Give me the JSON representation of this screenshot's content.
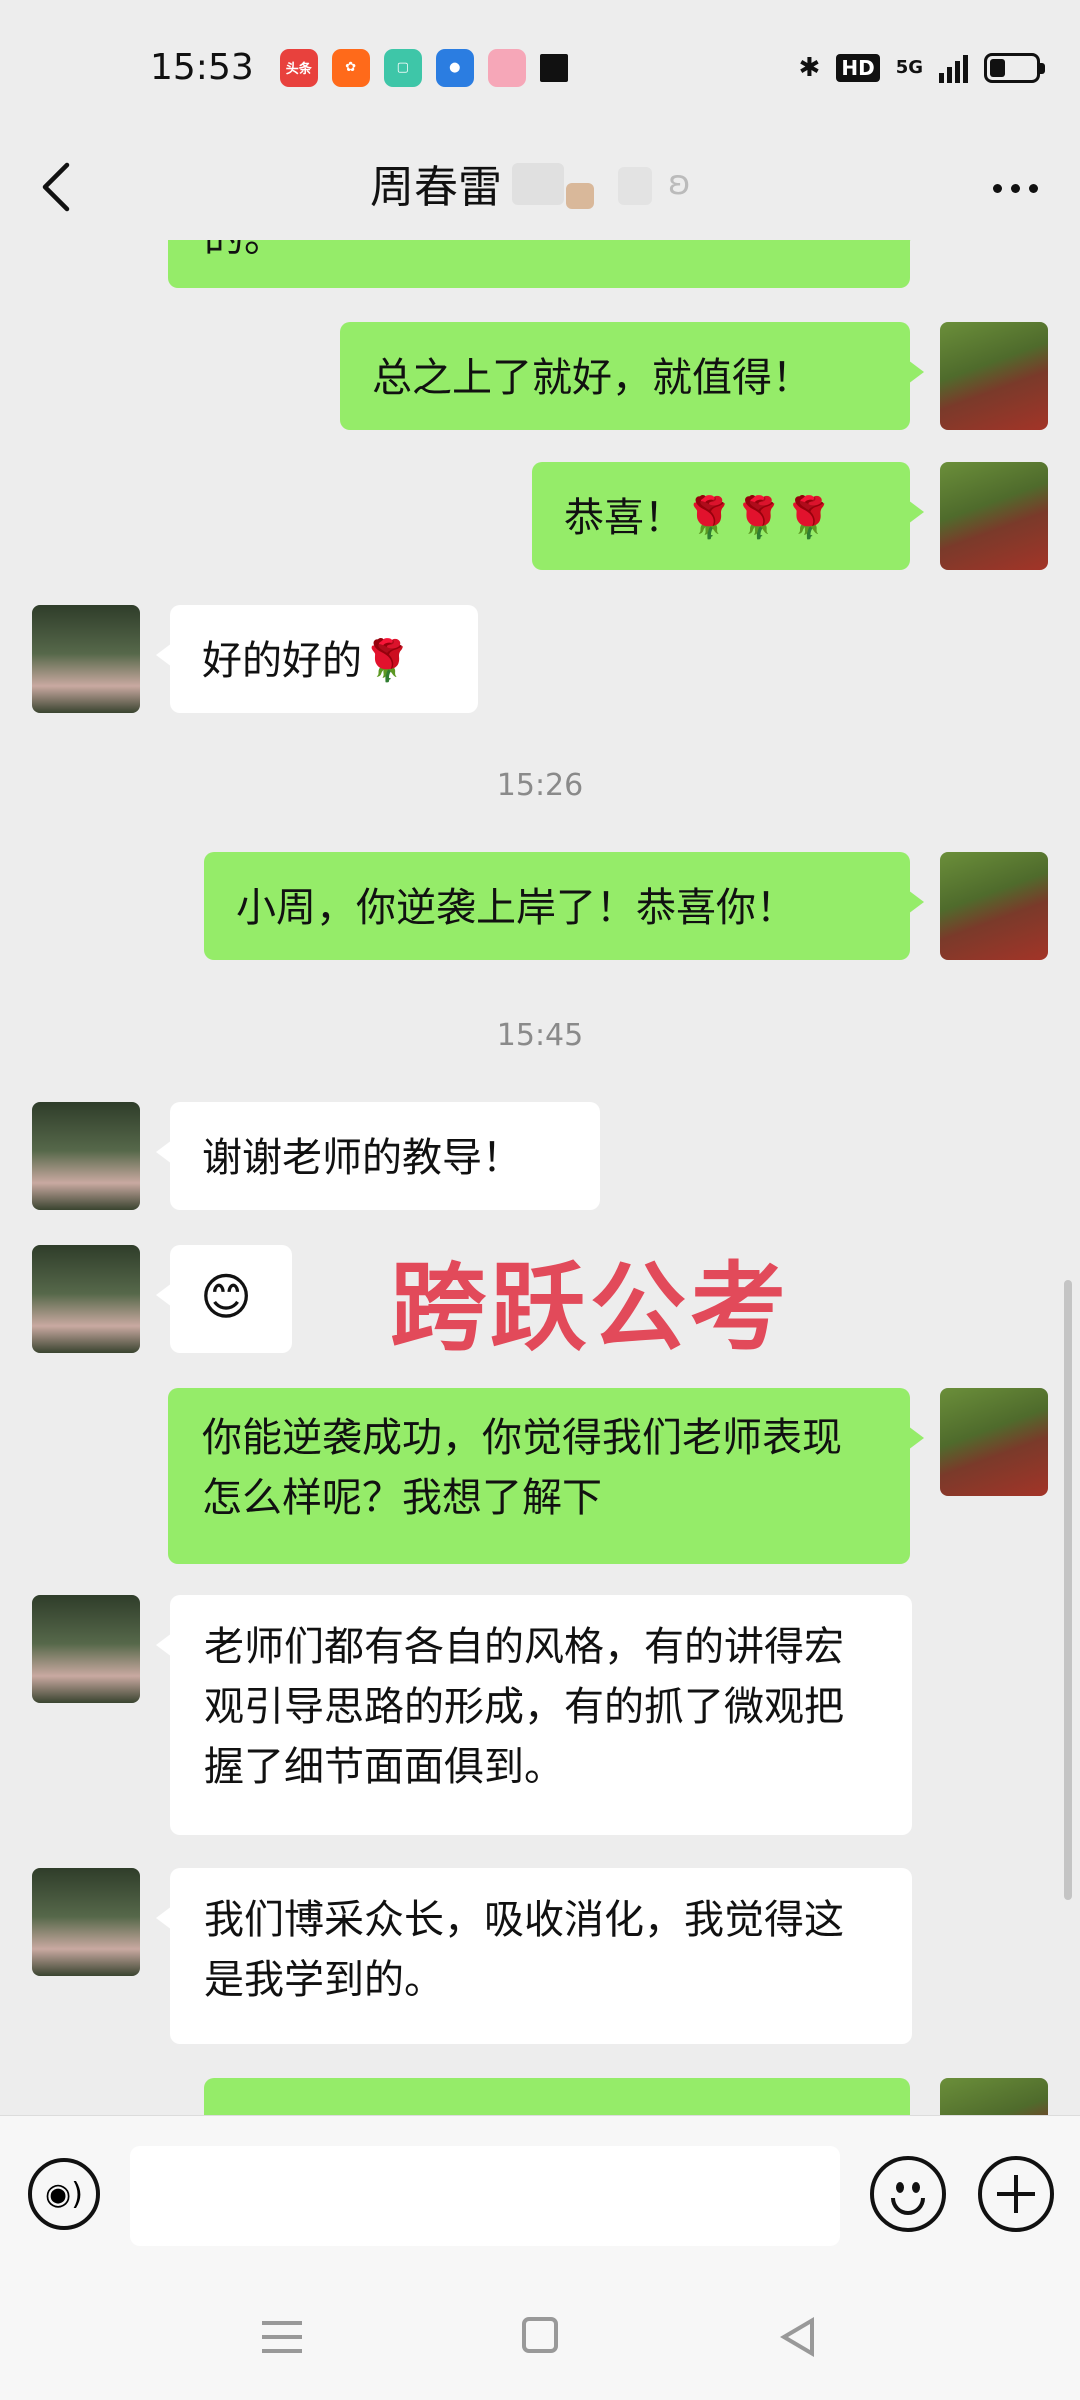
{
  "status_bar": {
    "time": "15:53",
    "app_icons": [
      {
        "name": "toutiao-icon",
        "label": "头条",
        "color": "#e8413d"
      },
      {
        "name": "kuaishou-icon",
        "label": "",
        "color": "#ff6a1a"
      },
      {
        "name": "app-green-icon",
        "label": "",
        "color": "#3ec6a8"
      },
      {
        "name": "app-blue-icon",
        "label": "",
        "color": "#2b7de1"
      },
      {
        "name": "app-pink-icon",
        "label": "",
        "color": "#f6a7b8"
      },
      {
        "name": "app-black-icon",
        "label": "",
        "color": "#111111"
      }
    ],
    "bluetooth": "✱",
    "hd": "HD",
    "network": "5G",
    "battery_level": 0.35
  },
  "header": {
    "title": "周春雷"
  },
  "messages": [
    {
      "side": "me",
      "text": "的。"
    },
    {
      "side": "me",
      "text": "总之上了就好，就值得！"
    },
    {
      "side": "me",
      "text": "恭喜！🌹🌹🌹"
    },
    {
      "side": "them",
      "text": "好的好的🌹"
    },
    {
      "side": "time",
      "text": "15:26"
    },
    {
      "side": "me",
      "text": "小周，你逆袭上岸了！恭喜你！"
    },
    {
      "side": "time",
      "text": "15:45"
    },
    {
      "side": "them",
      "text": "谢谢老师的教导！"
    },
    {
      "side": "them",
      "text": "😊"
    },
    {
      "side": "me",
      "text": "你能逆袭成功，你觉得我们老师表现怎么样呢？我想了解下"
    },
    {
      "side": "them",
      "text": "老师们都有各自的风格，有的讲得宏观引导思路的形成，有的抓了微观把握了细节面面俱到。"
    },
    {
      "side": "them",
      "text": "我们博采众长，吸收消化，我觉得这是我学到的。"
    },
    {
      "side": "me",
      "text": ""
    }
  ],
  "watermark": "跨跃公考",
  "input_bar": {
    "placeholder": ""
  }
}
